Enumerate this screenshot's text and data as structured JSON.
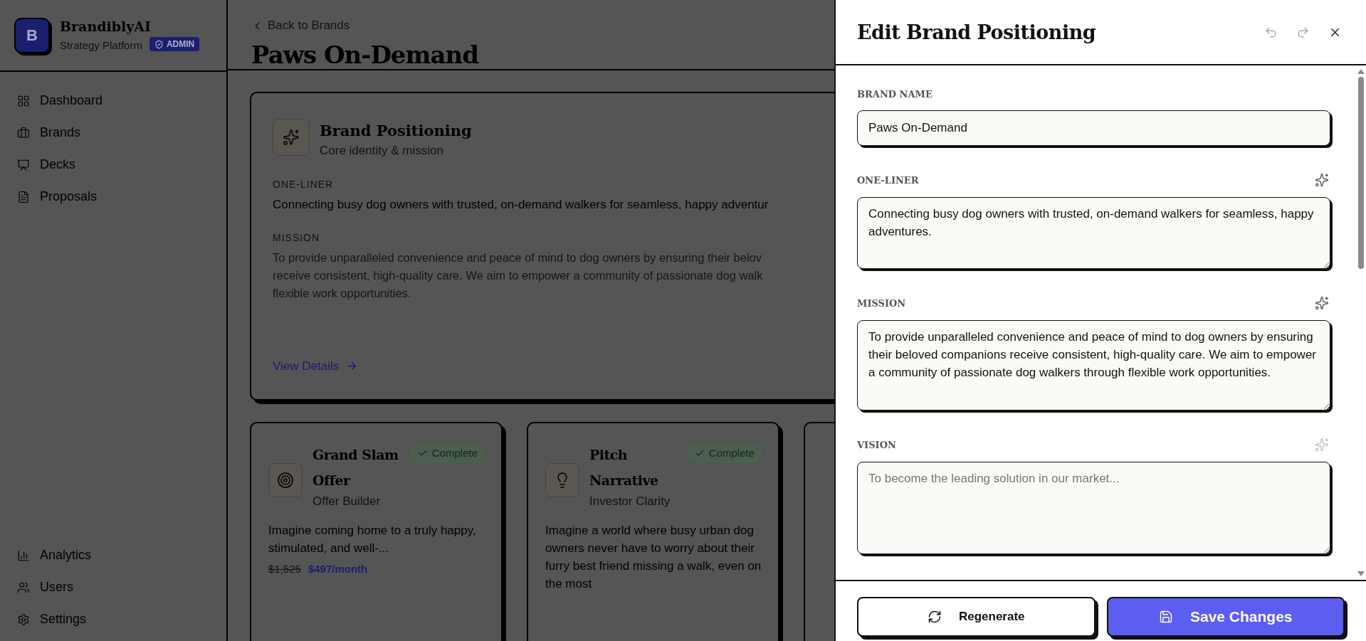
{
  "sidebar": {
    "logo_letter": "B",
    "app_name": "BrandiblyAI",
    "tagline": "Strategy Platform",
    "role_badge": "ADMIN",
    "nav_top": [
      {
        "kind": "dashboard",
        "label": "Dashboard"
      },
      {
        "kind": "brands",
        "label": "Brands"
      },
      {
        "kind": "decks",
        "label": "Decks"
      },
      {
        "kind": "proposals",
        "label": "Proposals"
      }
    ],
    "nav_bottom": [
      {
        "kind": "analytics",
        "label": "Analytics"
      },
      {
        "kind": "users",
        "label": "Users"
      },
      {
        "kind": "settings",
        "label": "Settings"
      }
    ]
  },
  "main": {
    "back_link": "Back to Brands",
    "title": "Paws On-Demand",
    "feature_card": {
      "title": "Brand Positioning",
      "subtitle": "Core identity & mission",
      "sections": [
        {
          "label": "ONE-LINER",
          "kind": "strong",
          "lines": [
            "Connecting busy dog owners with trusted, on-demand walkers for seamless, happy adventur"
          ]
        },
        {
          "label": "MISSION",
          "kind": "muted",
          "lines": [
            "To provide unparalleled convenience and peace of mind to dog owners by ensuring their belov",
            "receive consistent, high-quality care. We aim to empower a community of passionate dog walk",
            "flexible work opportunities."
          ]
        }
      ],
      "link": "View Details"
    },
    "cards": [
      {
        "title": "Grand Slam Offer",
        "status": "Complete",
        "subtitle": "Offer Builder",
        "description": "Imagine coming home to a truly happy, stimulated, and well-...",
        "old_price": "$1,525",
        "price": "$497/month"
      },
      {
        "title": "Pitch Narrative",
        "status": "Complete",
        "subtitle": "Investor Clarity",
        "description": "Imagine a world where busy urban dog owners never have to worry about their furry best friend missing a walk, even on the most"
      }
    ]
  },
  "drawer": {
    "title": "Edit Brand Positioning",
    "actions": [
      {
        "kind": "undo",
        "disabled": true
      },
      {
        "kind": "redo",
        "disabled": true
      },
      {
        "kind": "close",
        "disabled": false
      }
    ],
    "fields": [
      {
        "kind": "input",
        "label": "BRAND NAME",
        "value": "Paws On-Demand"
      },
      {
        "kind": "textarea",
        "label": "ONE-LINER",
        "ai_enabled": true,
        "value": "Connecting busy dog owners with trusted, on-demand walkers for seamless, happy adventures."
      },
      {
        "kind": "textarea",
        "label": "MISSION",
        "ai_enabled": true,
        "value": "To provide unparalleled convenience and peace of mind to dog owners by ensuring their beloved companions receive consistent, high-quality care. We aim to empower a community of passionate dog walkers through flexible work opportunities."
      },
      {
        "kind": "textarea",
        "label": "VISION",
        "ai_enabled": false,
        "placeholder": "To become the leading solution in our market..."
      }
    ],
    "buttons": [
      {
        "kind": "regenerate",
        "label": "Regenerate"
      },
      {
        "kind": "save",
        "label": "Save Changes"
      }
    ]
  }
}
